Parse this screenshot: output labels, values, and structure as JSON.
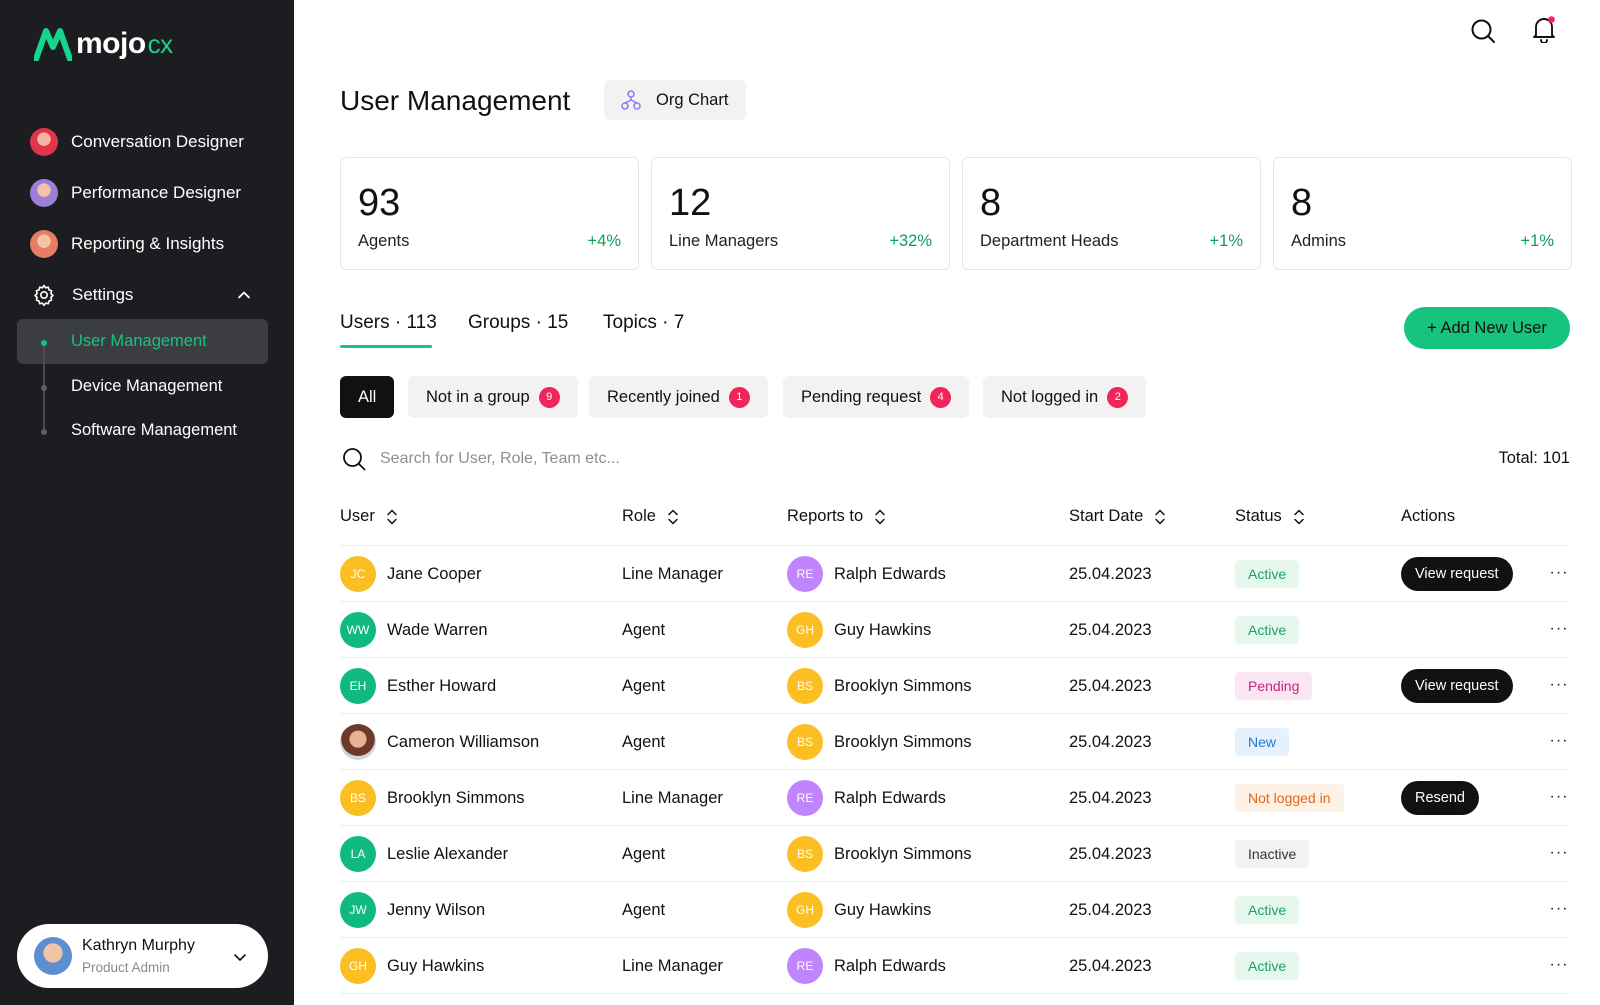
{
  "app": {
    "brand": "mojo",
    "brand_suffix": "cx"
  },
  "sidebar": {
    "items": [
      {
        "label": "Conversation Designer",
        "icon": "avatar-conversation"
      },
      {
        "label": "Performance Designer",
        "icon": "avatar-performance"
      },
      {
        "label": "Reporting & Insights",
        "icon": "avatar-reporting"
      },
      {
        "label": "Settings",
        "icon": "gear-icon"
      }
    ],
    "settings_sub": [
      {
        "label": "User Management",
        "active": true
      },
      {
        "label": "Device Management",
        "active": false
      },
      {
        "label": "Software Management",
        "active": false
      }
    ],
    "profile": {
      "name": "Kathryn Murphy",
      "role": "Product Admin"
    }
  },
  "header": {
    "title": "User Management",
    "org_chart_label": "Org Chart"
  },
  "stats": [
    {
      "value": "93",
      "label": "Agents",
      "change": "+4%"
    },
    {
      "value": "12",
      "label": "Line Managers",
      "change": "+32%"
    },
    {
      "value": "8",
      "label": "Department Heads",
      "change": "+1%"
    },
    {
      "value": "8",
      "label": "Admins",
      "change": "+1%"
    }
  ],
  "tabs": [
    {
      "label": "Users · 113",
      "active": true
    },
    {
      "label": "Groups · 15",
      "active": false
    },
    {
      "label": "Topics · 7",
      "active": false
    }
  ],
  "add_button": "+ Add New User",
  "filters": [
    {
      "label": "All",
      "count": null,
      "active": true
    },
    {
      "label": "Not in a group",
      "count": "9",
      "active": false
    },
    {
      "label": "Recently joined",
      "count": "1",
      "active": false
    },
    {
      "label": "Pending request",
      "count": "4",
      "active": false
    },
    {
      "label": "Not logged in",
      "count": "2",
      "active": false
    }
  ],
  "search": {
    "placeholder": "Search for User, Role, Team etc...",
    "value": ""
  },
  "total": "Total: 101",
  "table": {
    "columns": [
      "User",
      "Role",
      "Reports to",
      "Start Date",
      "Status",
      "Actions"
    ],
    "rows": [
      {
        "initials": "JC",
        "user": "Jane Cooper",
        "user_color": "#fbbf24",
        "role": "Line Manager",
        "rep_initials": "RE",
        "reports_to": "Ralph Edwards",
        "rep_color": "#c084fc",
        "date": "25.04.2023",
        "status": "Active",
        "action": "View request"
      },
      {
        "initials": "WW",
        "user": "Wade Warren",
        "user_color": "#10b981",
        "role": "Agent",
        "rep_initials": "GH",
        "reports_to": "Guy Hawkins",
        "rep_color": "#fbbf24",
        "date": "25.04.2023",
        "status": "Active",
        "action": ""
      },
      {
        "initials": "EH",
        "user": "Esther Howard",
        "user_color": "#10b981",
        "role": "Agent",
        "rep_initials": "BS",
        "reports_to": "Brooklyn Simmons",
        "rep_color": "#fbbf24",
        "date": "25.04.2023",
        "status": "Pending",
        "action": "View request"
      },
      {
        "initials": "",
        "user": "Cameron Williamson",
        "user_color": "photo",
        "role": "Agent",
        "rep_initials": "BS",
        "reports_to": "Brooklyn Simmons",
        "rep_color": "#fbbf24",
        "date": "25.04.2023",
        "status": "New",
        "action": ""
      },
      {
        "initials": "BS",
        "user": "Brooklyn Simmons",
        "user_color": "#fbbf24",
        "role": "Line Manager",
        "rep_initials": "RE",
        "reports_to": "Ralph Edwards",
        "rep_color": "#c084fc",
        "date": "25.04.2023",
        "status": "Not logged in",
        "action": "Resend"
      },
      {
        "initials": "LA",
        "user": "Leslie Alexander",
        "user_color": "#10b981",
        "role": "Agent",
        "rep_initials": "BS",
        "reports_to": "Brooklyn Simmons",
        "rep_color": "#fbbf24",
        "date": "25.04.2023",
        "status": "Inactive",
        "action": ""
      },
      {
        "initials": "JW",
        "user": "Jenny Wilson",
        "user_color": "#10b981",
        "role": "Agent",
        "rep_initials": "GH",
        "reports_to": "Guy Hawkins",
        "rep_color": "#fbbf24",
        "date": "25.04.2023",
        "status": "Active",
        "action": ""
      },
      {
        "initials": "GH",
        "user": "Guy Hawkins",
        "user_color": "#fbbf24",
        "role": "Line Manager",
        "rep_initials": "RE",
        "reports_to": "Ralph Edwards",
        "rep_color": "#c084fc",
        "date": "25.04.2023",
        "status": "Active",
        "action": ""
      }
    ]
  },
  "status_colors": {
    "Active": {
      "bg": "#e6f8ee",
      "fg": "#16a36a"
    },
    "Pending": {
      "bg": "#fbe7f3",
      "fg": "#c0267d"
    },
    "New": {
      "bg": "#e5f2fd",
      "fg": "#1f7bd0"
    },
    "Not logged in": {
      "bg": "#fef1e6",
      "fg": "#e0681e"
    },
    "Inactive": {
      "bg": "#f2f2f3",
      "fg": "#333333"
    }
  },
  "colors": {
    "accent": "#16c47e",
    "sidebar_bg": "#1c1d20",
    "badge": "#f0265a"
  }
}
